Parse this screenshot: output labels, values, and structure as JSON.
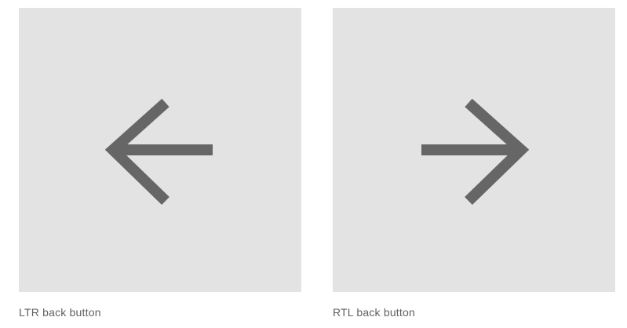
{
  "figures": [
    {
      "caption": "LTR back button",
      "icon": "arrow-left-icon",
      "background_color": "#e3e3e3",
      "icon_color": "#666666"
    },
    {
      "caption": "RTL back button",
      "icon": "arrow-right-icon",
      "background_color": "#e3e3e3",
      "icon_color": "#666666"
    }
  ]
}
